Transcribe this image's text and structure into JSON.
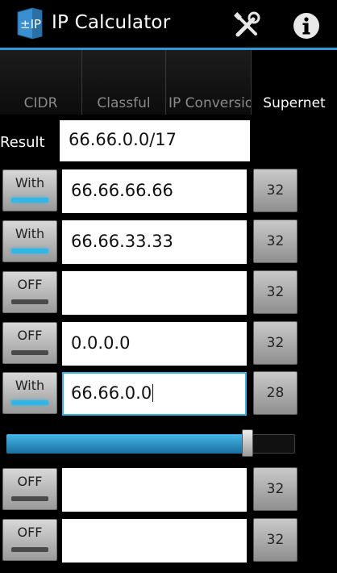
{
  "app": {
    "title": "IP Calculator",
    "icon_text": "±IP"
  },
  "tabs": [
    {
      "label": "CIDR",
      "active": false
    },
    {
      "label": "Classful",
      "active": false
    },
    {
      "label": "IP  Conversio",
      "active": false
    },
    {
      "label": "Supernet",
      "active": true
    }
  ],
  "result": {
    "label": "Result",
    "value": "66.66.0.0/17"
  },
  "rows": [
    {
      "toggle": "With",
      "on": true,
      "ip": "66.66.66.66",
      "mask": "32"
    },
    {
      "toggle": "With",
      "on": true,
      "ip": "66.66.33.33",
      "mask": "32"
    },
    {
      "toggle": "OFF",
      "on": false,
      "ip": "",
      "mask": "32"
    },
    {
      "toggle": "OFF",
      "on": false,
      "ip": "0.0.0.0",
      "mask": "32"
    },
    {
      "toggle": "With",
      "on": true,
      "ip": "66.66.0.0",
      "mask": "28",
      "focused": true
    },
    {
      "toggle": "OFF",
      "on": false,
      "ip": "",
      "mask": "32"
    },
    {
      "toggle": "OFF",
      "on": false,
      "ip": "",
      "mask": "32"
    }
  ],
  "slider": {
    "value_fraction": 0.85
  },
  "icons": {
    "tools": "tools-icon",
    "info": "info-icon"
  },
  "colors": {
    "accent": "#33b5e5",
    "actionbar_line": "#2f9bd6"
  }
}
